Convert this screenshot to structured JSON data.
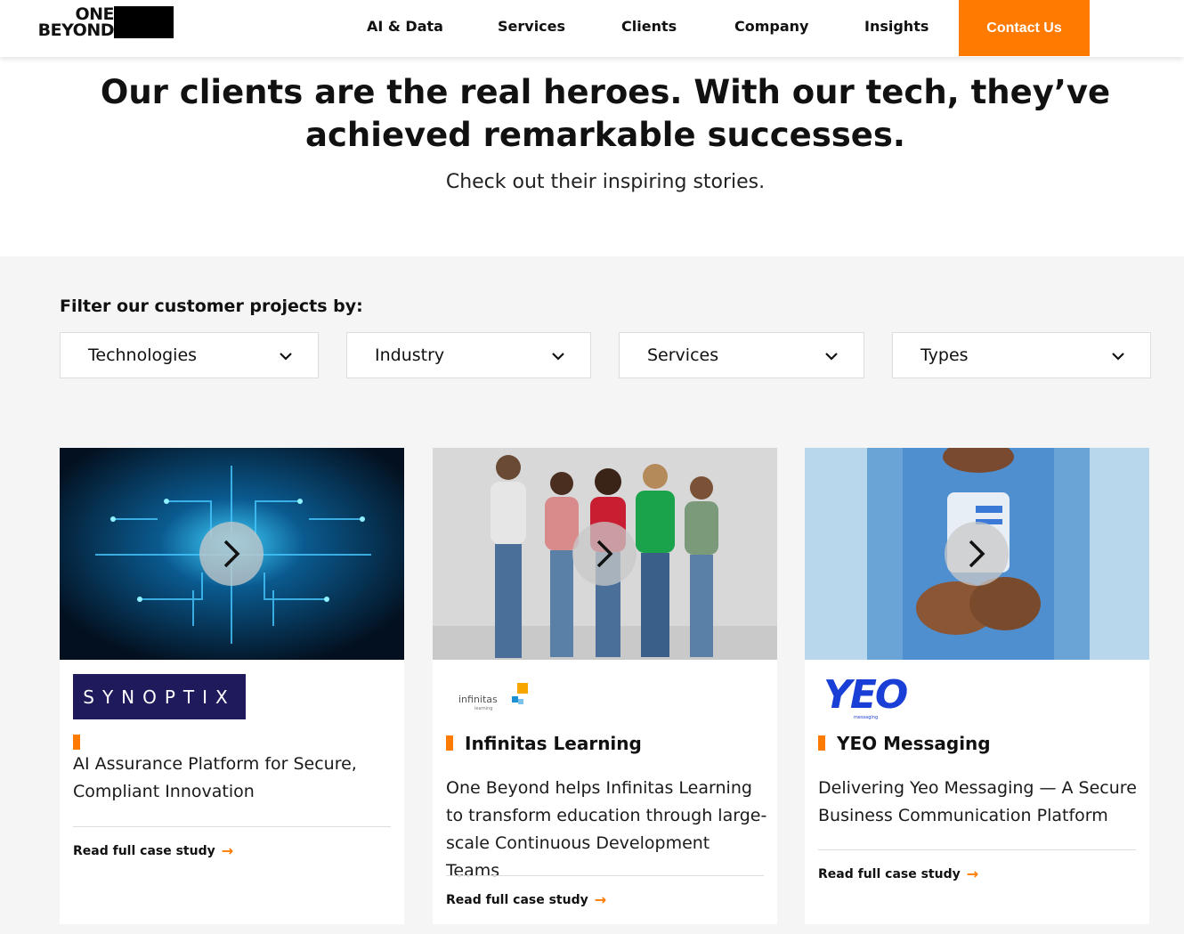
{
  "brand": {
    "line1": "ONE",
    "line2": "BEYOND"
  },
  "nav": {
    "items": [
      "AI & Data",
      "Services",
      "Clients",
      "Company",
      "Insights"
    ],
    "contact": "Contact Us"
  },
  "hero": {
    "title": "Our clients are the real heroes. With our tech, they’ve achieved remarkable successes.",
    "subtitle": "Check out their inspiring stories."
  },
  "filters": {
    "label": "Filter our customer projects by:",
    "options": [
      "Technologies",
      "Industry",
      "Services",
      "Types"
    ]
  },
  "cards": [
    {
      "logo_text": "SYNOPTIX",
      "title": "",
      "description": "AI Assurance Platform for Secure, Compliant Innovation",
      "link": "Read full case study"
    },
    {
      "logo_text": "infinitas",
      "logo_sub": "learning",
      "title": "Infinitas Learning",
      "description": "One Beyond helps Infinitas Learning to transform education through large-scale Continuous Development Teams",
      "link": "Read full case study"
    },
    {
      "logo_text": "YEO",
      "logo_sub": "messaging",
      "title": "YEO Messaging",
      "description": "Delivering Yeo Messaging — A Secure Business Communication Platform",
      "link": "Read full case study"
    }
  ],
  "colors": {
    "accent": "#ff7a00",
    "synoptix_bg": "#1f1a5c",
    "yeo_blue": "#1a3fd6"
  }
}
